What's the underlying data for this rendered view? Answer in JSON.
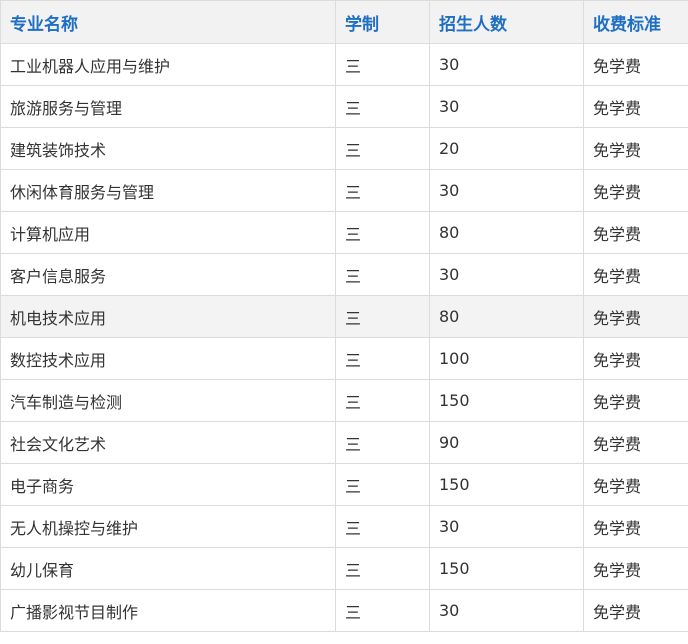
{
  "table": {
    "headers": [
      "专业名称",
      "学制",
      "招生人数",
      "收费标准"
    ],
    "rows": [
      [
        "工业机器人应用与维护",
        "三",
        "30",
        "免学费"
      ],
      [
        "旅游服务与管理",
        "三",
        "30",
        "免学费"
      ],
      [
        "建筑装饰技术",
        "三",
        "20",
        "免学费"
      ],
      [
        "休闲体育服务与管理",
        "三",
        "30",
        "免学费"
      ],
      [
        "计算机应用",
        "三",
        "80",
        "免学费"
      ],
      [
        "客户信息服务",
        "三",
        "30",
        "免学费"
      ],
      [
        "机电技术应用",
        "三",
        "80",
        "免学费"
      ],
      [
        "数控技术应用",
        "三",
        "100",
        "免学费"
      ],
      [
        "汽车制造与检测",
        "三",
        "150",
        "免学费"
      ],
      [
        "社会文化艺术",
        "三",
        "90",
        "免学费"
      ],
      [
        "电子商务",
        "三",
        "150",
        "免学费"
      ],
      [
        "无人机操控与维护",
        "三",
        "30",
        "免学费"
      ],
      [
        "幼儿保育",
        "三",
        "150",
        "免学费"
      ],
      [
        "广播影视节目制作",
        "三",
        "30",
        "免学费"
      ]
    ],
    "highlighted_row": 6,
    "colors": {
      "header_text": "#1f6fc4",
      "header_bg": "#f2f2f2",
      "border": "#dcdcdc",
      "body_text": "#333333",
      "highlight_bg": "#f3f3f3"
    }
  }
}
